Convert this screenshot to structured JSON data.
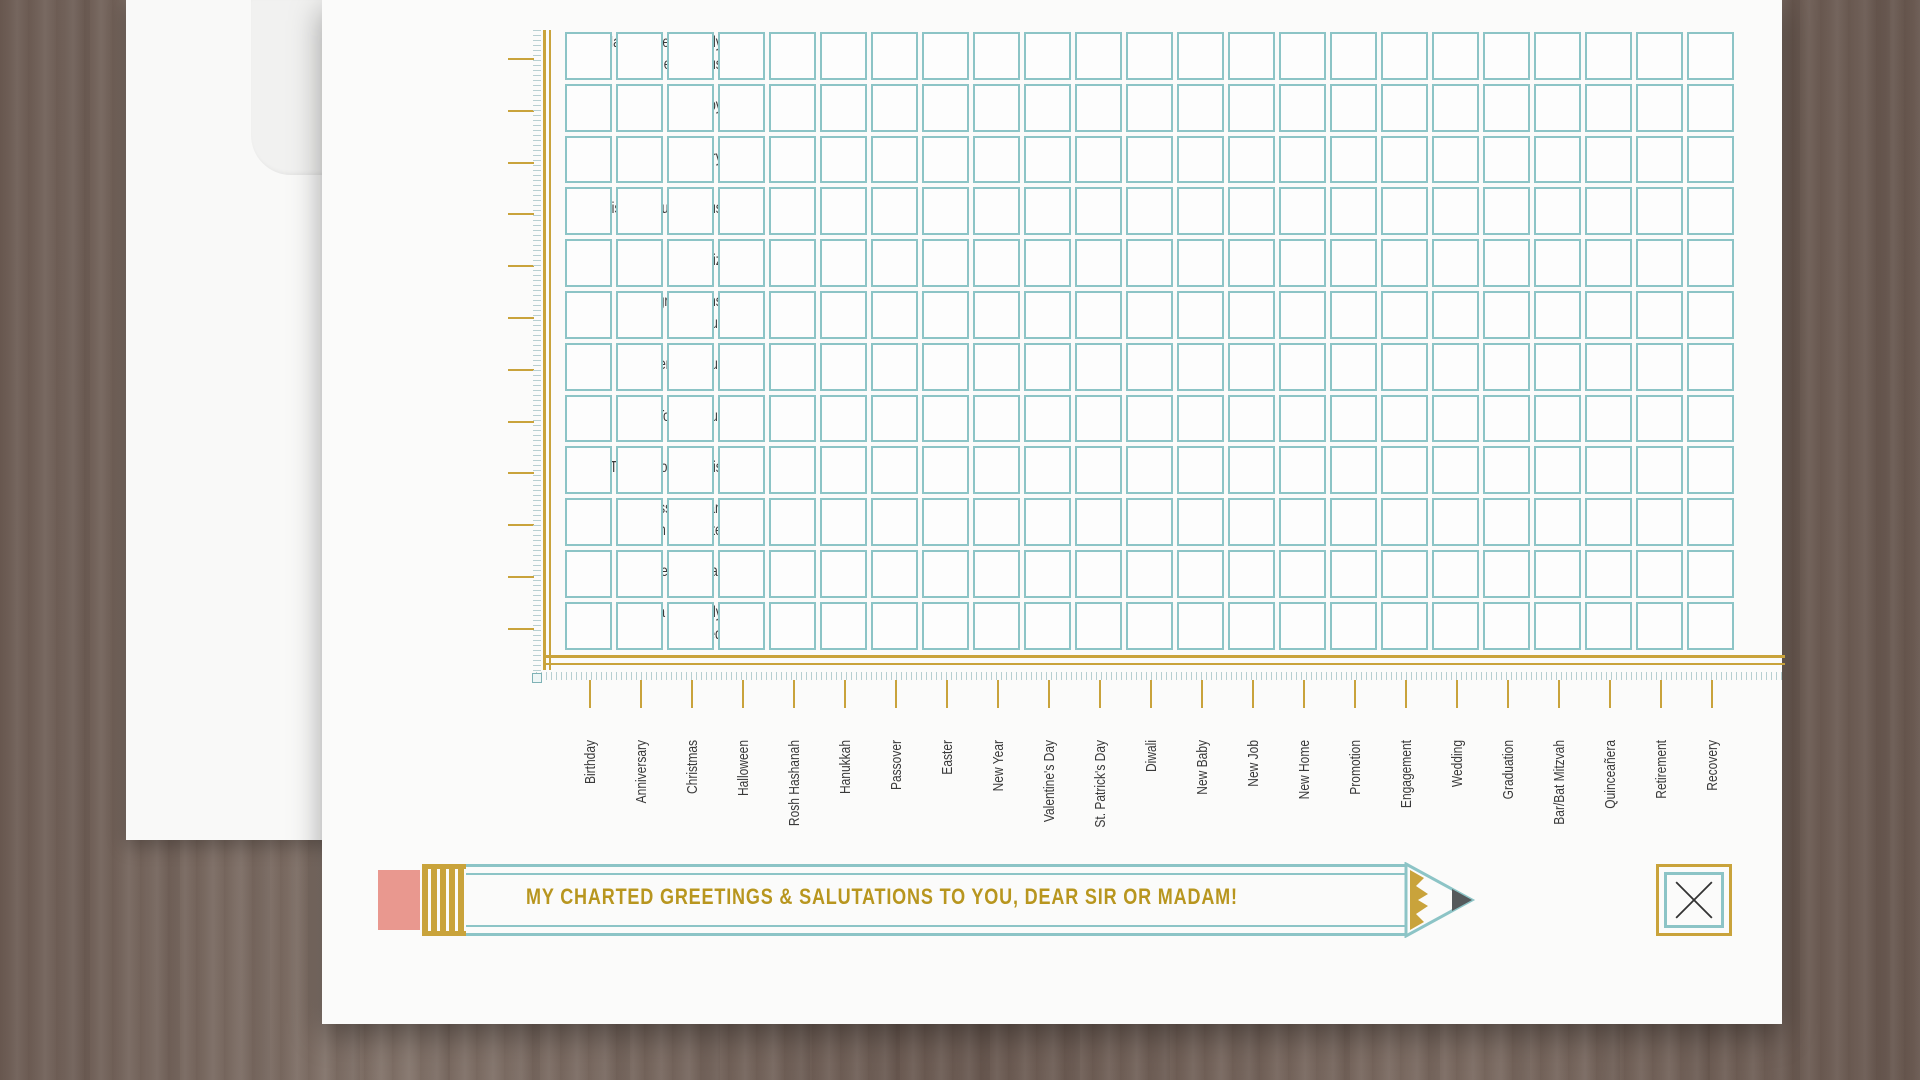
{
  "card": {
    "row_labels": [
      [
        "Have a Spectacularly",
        "Splendiferous"
      ],
      [
        "Happy"
      ],
      [
        "Merry"
      ],
      [
        "Wishing You a Joyous"
      ],
      [
        "Feliz"
      ],
      [
        "Congratulations",
        "on Your"
      ],
      [
        "Cheers on Your"
      ],
      [
        "Mazel Tov on Your"
      ],
      [
        "Thinking of You This"
      ],
      [
        "I Guess You Can",
        "Have an Adequate"
      ],
      [
        "Endure a Subpar"
      ],
      [
        "Have a Miserably",
        "Wretched"
      ]
    ],
    "column_labels": [
      "Birthday",
      "Anniversary",
      "Christmas",
      "Halloween",
      "Rosh Hashanah",
      "Hanukkah",
      "Passover",
      "Easter",
      "New Year",
      "Valentine's Day",
      "St. Patrick's Day",
      "Diwali",
      "New Baby",
      "New Job",
      "New Home",
      "Promotion",
      "Engagement",
      "Wedding",
      "Graduation",
      "Bar/Bat Mitzvah",
      "Quinceañera",
      "Retirement",
      "Recovery"
    ],
    "greeting": "MY CHARTED GREETINGS & SALUTATIONS TO YOU, DEAR SIR OR MADAM!",
    "colors": {
      "gold": "#c9a33b",
      "teal": "#8cc4c6",
      "eraser": "#e9988f",
      "card": "#fbfbfa"
    }
  }
}
